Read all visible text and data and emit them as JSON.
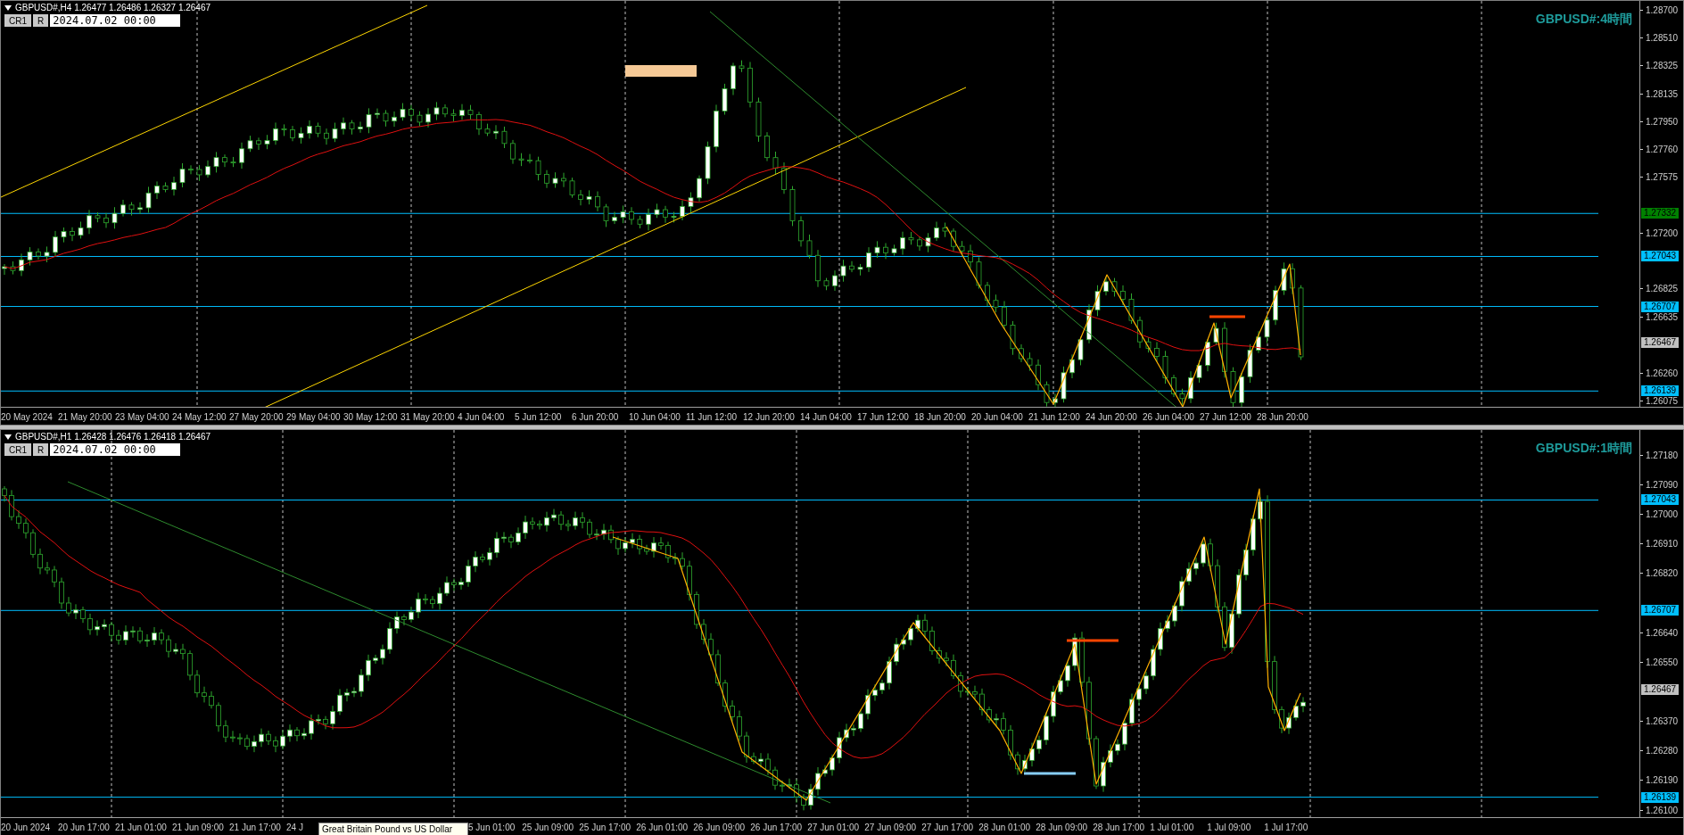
{
  "panels": [
    {
      "symbol_info": "GBPUSD#,H4  1.26477 1.26486 1.26327 1.26467",
      "buttons": [
        "CR1",
        "R"
      ],
      "date_field": "2024.07.02 00:00",
      "title": "GBPUSD#:4時間",
      "price_ticks": [
        "1.28700",
        "1.28510",
        "1.28325",
        "1.28135",
        "1.27950",
        "1.27760",
        "1.27575",
        "1.27200",
        "1.26825",
        "1.26635",
        "1.26260",
        "1.26075"
      ],
      "price_levels": [
        {
          "label": "1.27332",
          "kind": "level",
          "color": "#008000"
        },
        {
          "label": "1.27043",
          "kind": "level",
          "color": "#00bfff"
        },
        {
          "label": "1.26707",
          "kind": "level",
          "color": "#00bfff"
        },
        {
          "label": "1.26467",
          "kind": "price",
          "color": "#c0c0c0"
        },
        {
          "label": "1.26139",
          "kind": "level",
          "color": "#00bfff"
        }
      ],
      "time_axis": [
        {
          "kind": "label",
          "text": "20 May 2024"
        },
        {
          "kind": "label",
          "text": "21 May 20:00"
        },
        {
          "kind": "label",
          "text": "23 May 04:00"
        },
        {
          "kind": "label",
          "text": "24 May 12:00"
        },
        {
          "kind": "label",
          "text": "27 May 20:00"
        },
        {
          "kind": "label",
          "text": "29 May 04:00"
        },
        {
          "kind": "label",
          "text": "30 May 12:00"
        },
        {
          "kind": "label",
          "text": "31 May 20:00"
        },
        {
          "kind": "label",
          "text": "4 Jun 04:00"
        },
        {
          "kind": "label",
          "text": "5 Jun 12:00"
        },
        {
          "kind": "label",
          "text": "6 Jun 20:00"
        },
        {
          "kind": "label",
          "text": "10 Jun 04:00"
        },
        {
          "kind": "label",
          "text": "11 Jun 12:00"
        },
        {
          "kind": "label",
          "text": "12 Jun 20:00"
        },
        {
          "kind": "label",
          "text": "14 Jun 04:00"
        },
        {
          "kind": "label",
          "text": "17 Jun 12:00"
        },
        {
          "kind": "label",
          "text": "18 Jun 20:00"
        },
        {
          "kind": "label",
          "text": "20 Jun 04:00"
        },
        {
          "kind": "label",
          "text": "21 Jun 12:00"
        },
        {
          "kind": "label",
          "text": "24 Jun 20:00"
        },
        {
          "kind": "label",
          "text": "26 Jun 04:00"
        },
        {
          "kind": "label",
          "text": "27 Jun 12:00"
        },
        {
          "kind": "label",
          "text": "28 Jun 20:00"
        }
      ]
    },
    {
      "symbol_info": "GBPUSD#,H1  1.26428 1.26476 1.26418 1.26467",
      "buttons": [
        "CR1",
        "R"
      ],
      "date_field": "2024.07.02 00:00",
      "title": "GBPUSD#:1時間",
      "price_ticks": [
        "1.27180",
        "1.27090",
        "1.27000",
        "1.26910",
        "1.26820",
        "1.26640",
        "1.26550",
        "1.26370",
        "1.26280",
        "1.26190",
        "1.26100"
      ],
      "price_levels": [
        {
          "label": "1.27043",
          "kind": "level",
          "color": "#00bfff"
        },
        {
          "label": "1.26707",
          "kind": "level",
          "color": "#00bfff"
        },
        {
          "label": "1.26467",
          "kind": "price",
          "color": "#c0c0c0"
        },
        {
          "label": "1.26139",
          "kind": "level",
          "color": "#00bfff"
        }
      ],
      "time_axis": [
        {
          "kind": "label",
          "text": "20 Jun 2024"
        },
        {
          "kind": "label",
          "text": "20 Jun 17:00"
        },
        {
          "kind": "label",
          "text": "21 Jun 01:00"
        },
        {
          "kind": "label",
          "text": "21 Jun 09:00"
        },
        {
          "kind": "label",
          "text": "21 Jun 17:00"
        },
        {
          "kind": "partial",
          "text": "24 J"
        },
        {
          "kind": "tooltip",
          "text": "Great Britain Pound vs US Dollar"
        },
        {
          "kind": "partial",
          "text": "5 Jun 01:00"
        },
        {
          "kind": "label",
          "text": "25 Jun 09:00"
        },
        {
          "kind": "label",
          "text": "25 Jun 17:00"
        },
        {
          "kind": "label",
          "text": "26 Jun 01:00"
        },
        {
          "kind": "label",
          "text": "26 Jun 09:00"
        },
        {
          "kind": "label",
          "text": "26 Jun 17:00"
        },
        {
          "kind": "label",
          "text": "27 Jun 01:00"
        },
        {
          "kind": "label",
          "text": "27 Jun 09:00"
        },
        {
          "kind": "label",
          "text": "27 Jun 17:00"
        },
        {
          "kind": "label",
          "text": "28 Jun 01:00"
        },
        {
          "kind": "label",
          "text": "28 Jun 09:00"
        },
        {
          "kind": "label",
          "text": "28 Jun 17:00"
        },
        {
          "kind": "label",
          "text": "1 Jul 01:00"
        },
        {
          "kind": "label",
          "text": "1 Jul 09:00"
        },
        {
          "kind": "label",
          "text": "1 Jul 17:00"
        }
      ]
    }
  ]
}
